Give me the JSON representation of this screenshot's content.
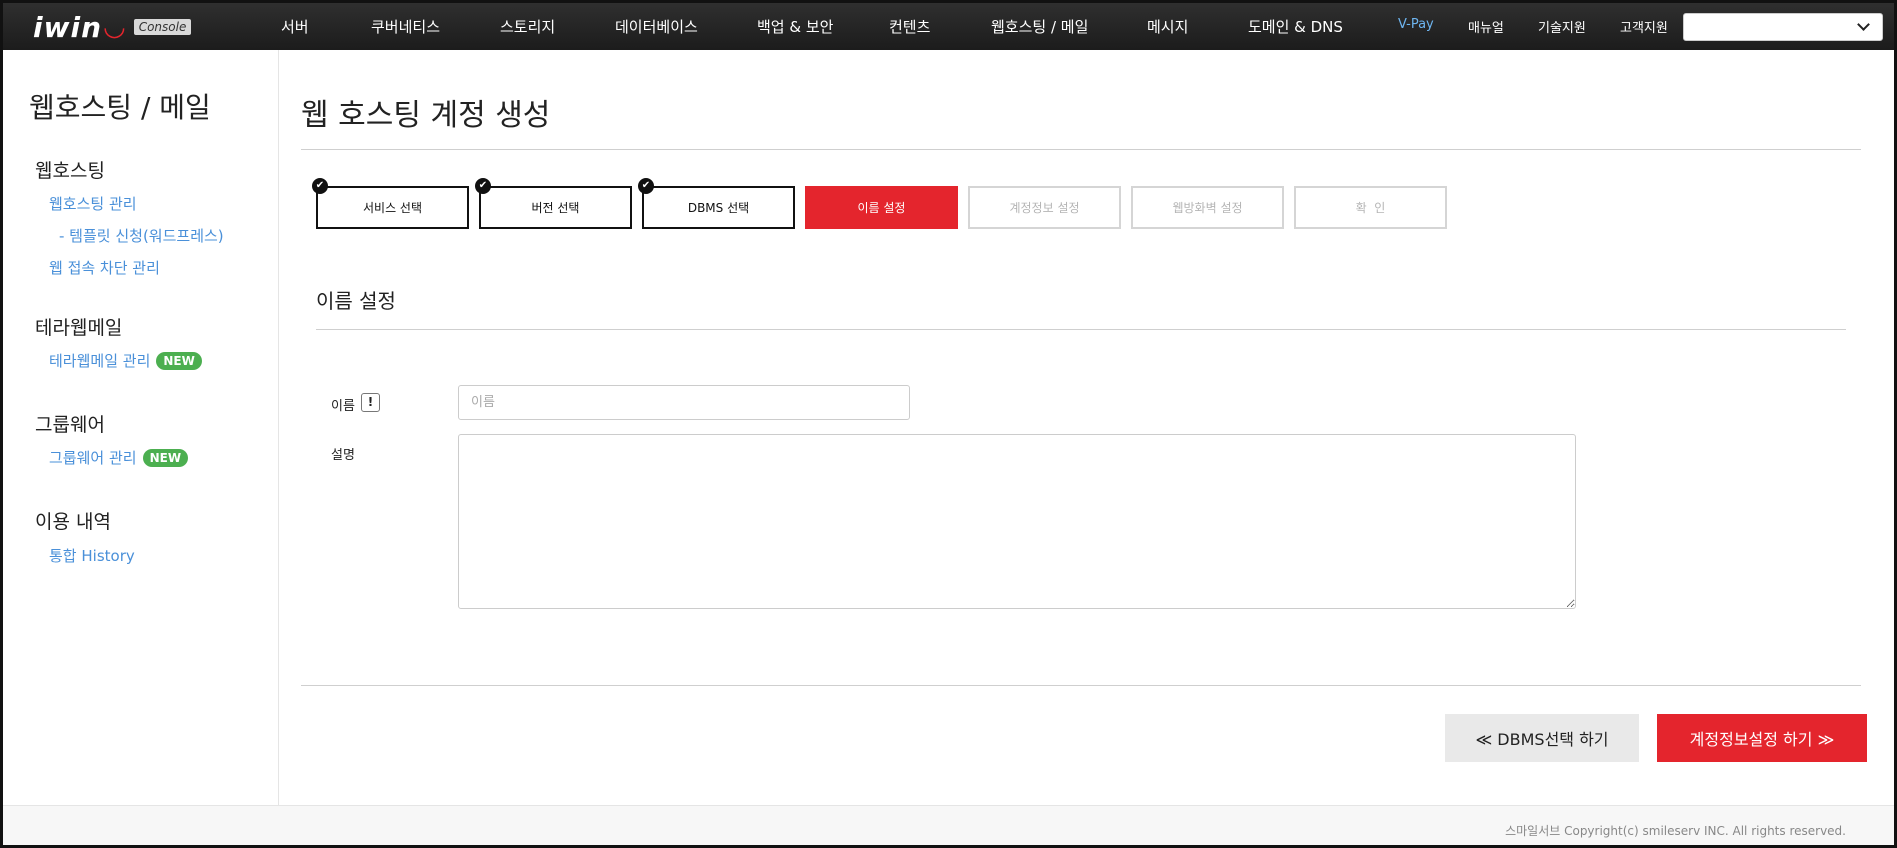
{
  "brand": {
    "logo": "iwin",
    "console": "Console"
  },
  "nav": {
    "items": [
      "서버",
      "쿠버네티스",
      "스토리지",
      "데이터베이스",
      "백업 & 보안",
      "컨텐츠",
      "웹호스팅 / 메일",
      "메시지",
      "도메인 & DNS"
    ],
    "vpay": "V-Pay",
    "utils": [
      "매뉴얼",
      "기술지원",
      "고객지원"
    ],
    "select_value": ""
  },
  "sidebar": {
    "title": "웹호스팅 / 메일",
    "groups": [
      {
        "title": "웹호스팅",
        "links": [
          "웹호스팅 관리",
          "- 템플릿 신청(워드프레스)",
          "웹 접속 차단 관리"
        ]
      },
      {
        "title": "테라웹메일",
        "links": [
          "테라웹메일 관리"
        ],
        "badge": "NEW"
      },
      {
        "title": "그룹웨어",
        "links": [
          "그룹웨어 관리"
        ],
        "badge": "NEW"
      },
      {
        "title": "이용 내역",
        "links": [
          "통합 History"
        ]
      }
    ]
  },
  "main": {
    "title": "웹 호스팅 계정 생성",
    "steps": [
      {
        "label": "서비스 선택",
        "state": "done"
      },
      {
        "label": "버전 선택",
        "state": "done"
      },
      {
        "label": "DBMS 선택",
        "state": "done"
      },
      {
        "label": "이름 설정",
        "state": "active"
      },
      {
        "label": "계정정보 설정",
        "state": "disabled"
      },
      {
        "label": "웹방화벽 설정",
        "state": "disabled"
      },
      {
        "label": "확  인",
        "state": "disabled"
      }
    ],
    "section_title": "이름 설정",
    "form": {
      "name_label": "이름",
      "name_placeholder": "이름",
      "name_value": "",
      "info_icon": "!",
      "desc_label": "설명",
      "desc_value": ""
    },
    "buttons": {
      "prev": "≪ DBMS선택 하기",
      "next": "계정정보설정 하기 ≫"
    }
  },
  "footer": {
    "copyright": "스마일서브 Copyright(c) smileserv INC. All rights reserved."
  },
  "colors": {
    "accent": "#e4252d",
    "link": "#4a90d9",
    "badge": "#4caf50",
    "nav_bg": "#222222"
  }
}
